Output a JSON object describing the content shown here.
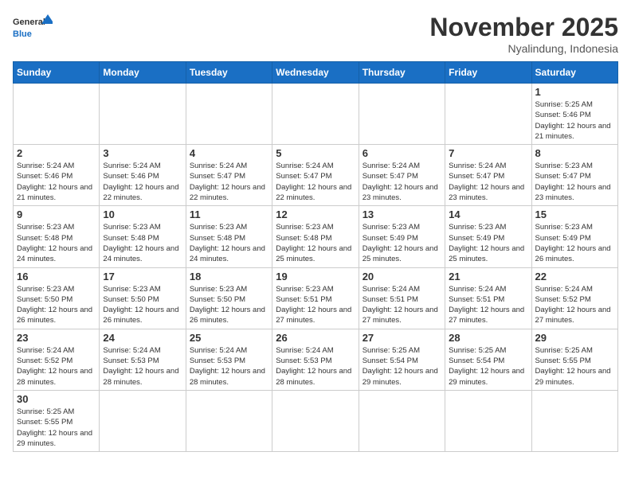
{
  "header": {
    "logo_general": "General",
    "logo_blue": "Blue",
    "month_title": "November 2025",
    "location": "Nyalindung, Indonesia"
  },
  "weekdays": [
    "Sunday",
    "Monday",
    "Tuesday",
    "Wednesday",
    "Thursday",
    "Friday",
    "Saturday"
  ],
  "weeks": [
    [
      {
        "day": "",
        "info": ""
      },
      {
        "day": "",
        "info": ""
      },
      {
        "day": "",
        "info": ""
      },
      {
        "day": "",
        "info": ""
      },
      {
        "day": "",
        "info": ""
      },
      {
        "day": "",
        "info": ""
      },
      {
        "day": "1",
        "info": "Sunrise: 5:25 AM\nSunset: 5:46 PM\nDaylight: 12 hours and 21 minutes."
      }
    ],
    [
      {
        "day": "2",
        "info": "Sunrise: 5:24 AM\nSunset: 5:46 PM\nDaylight: 12 hours and 21 minutes."
      },
      {
        "day": "3",
        "info": "Sunrise: 5:24 AM\nSunset: 5:46 PM\nDaylight: 12 hours and 22 minutes."
      },
      {
        "day": "4",
        "info": "Sunrise: 5:24 AM\nSunset: 5:47 PM\nDaylight: 12 hours and 22 minutes."
      },
      {
        "day": "5",
        "info": "Sunrise: 5:24 AM\nSunset: 5:47 PM\nDaylight: 12 hours and 22 minutes."
      },
      {
        "day": "6",
        "info": "Sunrise: 5:24 AM\nSunset: 5:47 PM\nDaylight: 12 hours and 23 minutes."
      },
      {
        "day": "7",
        "info": "Sunrise: 5:24 AM\nSunset: 5:47 PM\nDaylight: 12 hours and 23 minutes."
      },
      {
        "day": "8",
        "info": "Sunrise: 5:23 AM\nSunset: 5:47 PM\nDaylight: 12 hours and 23 minutes."
      }
    ],
    [
      {
        "day": "9",
        "info": "Sunrise: 5:23 AM\nSunset: 5:48 PM\nDaylight: 12 hours and 24 minutes."
      },
      {
        "day": "10",
        "info": "Sunrise: 5:23 AM\nSunset: 5:48 PM\nDaylight: 12 hours and 24 minutes."
      },
      {
        "day": "11",
        "info": "Sunrise: 5:23 AM\nSunset: 5:48 PM\nDaylight: 12 hours and 24 minutes."
      },
      {
        "day": "12",
        "info": "Sunrise: 5:23 AM\nSunset: 5:48 PM\nDaylight: 12 hours and 25 minutes."
      },
      {
        "day": "13",
        "info": "Sunrise: 5:23 AM\nSunset: 5:49 PM\nDaylight: 12 hours and 25 minutes."
      },
      {
        "day": "14",
        "info": "Sunrise: 5:23 AM\nSunset: 5:49 PM\nDaylight: 12 hours and 25 minutes."
      },
      {
        "day": "15",
        "info": "Sunrise: 5:23 AM\nSunset: 5:49 PM\nDaylight: 12 hours and 26 minutes."
      }
    ],
    [
      {
        "day": "16",
        "info": "Sunrise: 5:23 AM\nSunset: 5:50 PM\nDaylight: 12 hours and 26 minutes."
      },
      {
        "day": "17",
        "info": "Sunrise: 5:23 AM\nSunset: 5:50 PM\nDaylight: 12 hours and 26 minutes."
      },
      {
        "day": "18",
        "info": "Sunrise: 5:23 AM\nSunset: 5:50 PM\nDaylight: 12 hours and 26 minutes."
      },
      {
        "day": "19",
        "info": "Sunrise: 5:23 AM\nSunset: 5:51 PM\nDaylight: 12 hours and 27 minutes."
      },
      {
        "day": "20",
        "info": "Sunrise: 5:24 AM\nSunset: 5:51 PM\nDaylight: 12 hours and 27 minutes."
      },
      {
        "day": "21",
        "info": "Sunrise: 5:24 AM\nSunset: 5:51 PM\nDaylight: 12 hours and 27 minutes."
      },
      {
        "day": "22",
        "info": "Sunrise: 5:24 AM\nSunset: 5:52 PM\nDaylight: 12 hours and 27 minutes."
      }
    ],
    [
      {
        "day": "23",
        "info": "Sunrise: 5:24 AM\nSunset: 5:52 PM\nDaylight: 12 hours and 28 minutes."
      },
      {
        "day": "24",
        "info": "Sunrise: 5:24 AM\nSunset: 5:53 PM\nDaylight: 12 hours and 28 minutes."
      },
      {
        "day": "25",
        "info": "Sunrise: 5:24 AM\nSunset: 5:53 PM\nDaylight: 12 hours and 28 minutes."
      },
      {
        "day": "26",
        "info": "Sunrise: 5:24 AM\nSunset: 5:53 PM\nDaylight: 12 hours and 28 minutes."
      },
      {
        "day": "27",
        "info": "Sunrise: 5:25 AM\nSunset: 5:54 PM\nDaylight: 12 hours and 29 minutes."
      },
      {
        "day": "28",
        "info": "Sunrise: 5:25 AM\nSunset: 5:54 PM\nDaylight: 12 hours and 29 minutes."
      },
      {
        "day": "29",
        "info": "Sunrise: 5:25 AM\nSunset: 5:55 PM\nDaylight: 12 hours and 29 minutes."
      }
    ],
    [
      {
        "day": "30",
        "info": "Sunrise: 5:25 AM\nSunset: 5:55 PM\nDaylight: 12 hours and 29 minutes."
      },
      {
        "day": "",
        "info": ""
      },
      {
        "day": "",
        "info": ""
      },
      {
        "day": "",
        "info": ""
      },
      {
        "day": "",
        "info": ""
      },
      {
        "day": "",
        "info": ""
      },
      {
        "day": "",
        "info": ""
      }
    ]
  ]
}
